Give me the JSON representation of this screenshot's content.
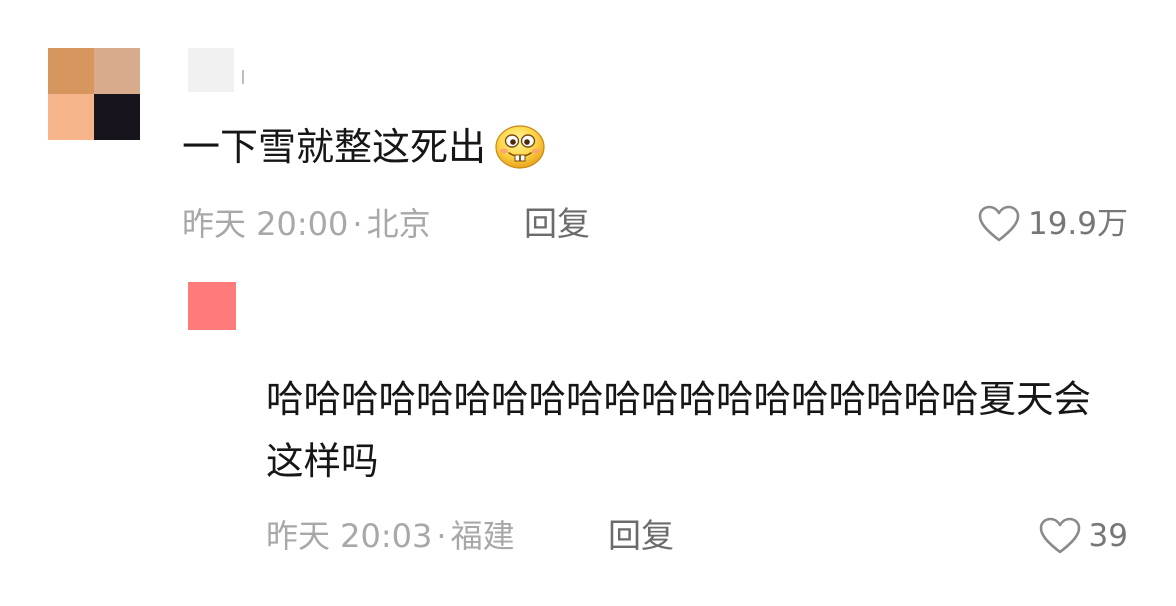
{
  "main_comment": {
    "text": "一下雪就整这死出",
    "emoji": "grinning-buck-tooth-emoji",
    "time": "昨天 20:00",
    "separator": "·",
    "location": "北京",
    "reply_label": "回复",
    "likes": "19.9万"
  },
  "reply_comment": {
    "text": "哈哈哈哈哈哈哈哈哈哈哈哈哈哈哈哈哈哈哈夏天会这样吗",
    "time": "昨天 20:03",
    "separator": "·",
    "location": "福建",
    "reply_label": "回复",
    "likes": "39"
  },
  "colors": {
    "text_primary": "#161616",
    "text_meta": "#a8a8a8",
    "reply_label": "#6b6b6b",
    "heart_outline": "#8a8a8a",
    "reply_avatar": "#ff7b7b"
  },
  "icons": {
    "like_icon": "heart-outline-icon"
  }
}
